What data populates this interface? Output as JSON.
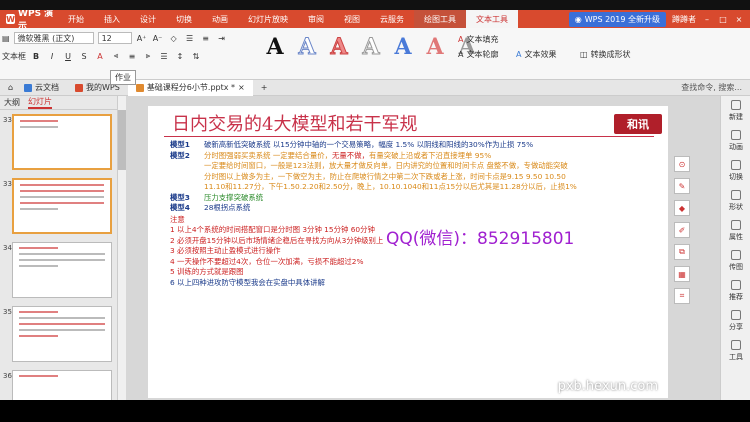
{
  "app": {
    "name": "WPS 演示"
  },
  "ribbon_tabs": [
    "开始",
    "插入",
    "设计",
    "切换",
    "动画",
    "幻灯片放映",
    "审阅",
    "视图",
    "云服务",
    "绘图工具",
    "文本工具"
  ],
  "active_tab": "文本工具",
  "promo": "WPS 2019 全新升级",
  "user": "蹲蹲者",
  "ribbon": {
    "textbox_label": "文本框",
    "font_name": "微软雅黑 (正文)",
    "font_size": "12",
    "text_fill": "文本填充",
    "text_outline": "文本轮廓",
    "text_effect": "文本效果",
    "convert_shape": "转换成形状"
  },
  "doc_tabs": [
    {
      "label": "云文档",
      "color": "#3a7bd5"
    },
    {
      "label": "我的WPS",
      "color": "#d84a2e"
    },
    {
      "label": "基础课程分6小节.pptx *",
      "color": "#e08a30"
    }
  ],
  "search_hint": "查找命令, 搜索...",
  "left_pane": {
    "tab_outline": "大纲",
    "tab_slides": "幻灯片",
    "slide_numbers": [
      "33",
      "33",
      "34",
      "35",
      "36"
    ],
    "tooltip": "作业"
  },
  "slide": {
    "title": "日内交易的4大模型和若干军规",
    "logo": "和讯",
    "line1_label": "模型1",
    "line1_text": "破新高新低突破系统  以15分钟中轴的一个交易策略，幅度 1.5% 以阴线和阳线的30%作为止损 75%",
    "line2_label": "模型2",
    "line2_a": "分时图强弱买卖系统  一定要结合量价，",
    "line2_b": "无量不做，",
    "line2_c": "有量突破上沿或者下沿直接埋单 95%",
    "line3": "一定要给时间窗口，一般是123法则，放大量才做反向单，日内讲究的位置和时间卡点 盘整不做，专做动能突破",
    "line4": "分时图以上做多为主，一下做空为主，防止在爬坡行情之中第二次下跌或者上涨，时间卡点是9.15  9.50  10.50",
    "line5": "11.10和11.27分，下午1.50.2.20和2.50分，晚上，10.10.1040和11点15分以后尤其是11.28分以后，止损1%",
    "line6_label": "模型3",
    "line6_text": "压力支撑突破系统",
    "line7_label": "模型4",
    "line7_text": "28根拐点系统",
    "note_title": "注意",
    "notes": [
      "1 以上4个系统的时间搭配窗口是分时图  3分钟   15分钟   60分钟",
      "2 必须开盘15分钟以后市场情绪企稳后在寻找方向从3分钟级别上",
      "3 必须按照主动止盈模式进行操作",
      "4 一天操作不要超过4次，仓位一次加满，亏损不能超过2%",
      "5 训练的方式就是跟图",
      "6  以上四种进攻防守模型我会在实盘中具体讲解"
    ],
    "qq": "QQ(微信)：852915801",
    "watermark": "pxb.hexun.com"
  },
  "right_pane": [
    "新建",
    "动画",
    "切换",
    "形状",
    "属性",
    "传图",
    "推荐",
    "分享",
    "工具"
  ]
}
